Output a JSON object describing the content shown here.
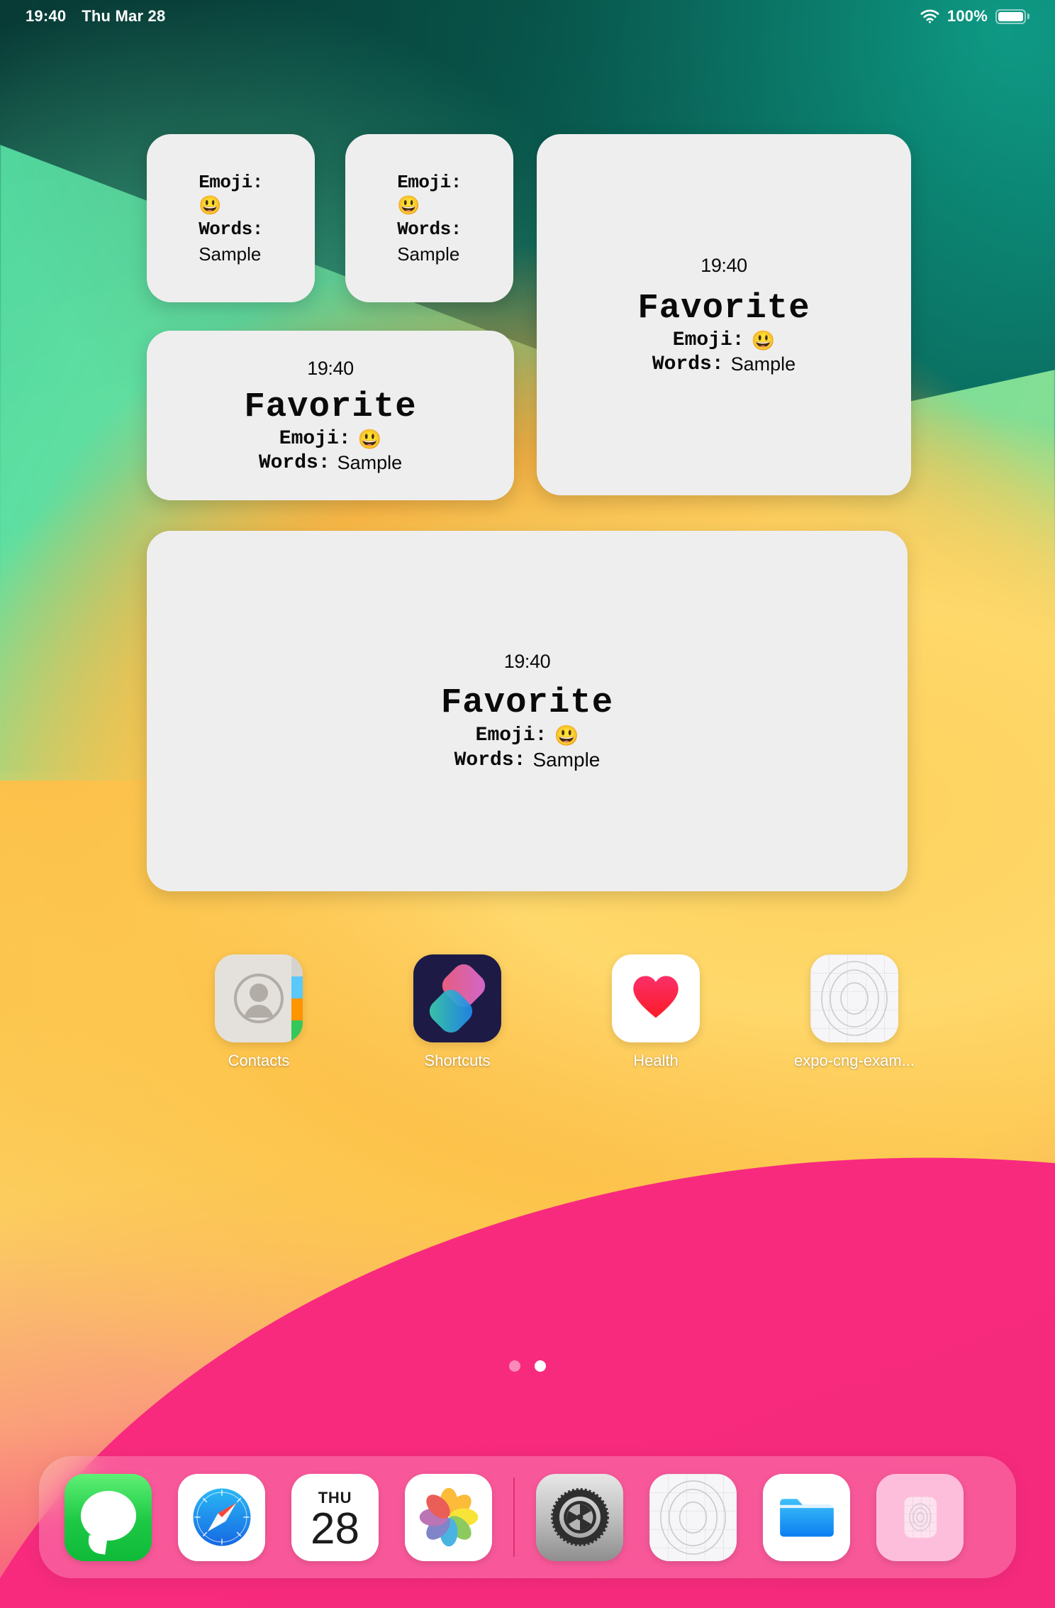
{
  "status_bar": {
    "time": "19:40",
    "date": "Thu Mar 28",
    "wifi_icon": "wifi-icon",
    "battery_percent": "100%",
    "battery_icon": "battery-full-icon"
  },
  "widgets": [
    {
      "id": "small-1",
      "size": "small",
      "emoji_label": "Emoji:",
      "emoji_value": "😃",
      "words_label": "Words:",
      "words_value": "Sample"
    },
    {
      "id": "small-2",
      "size": "small",
      "emoji_label": "Emoji:",
      "emoji_value": "😃",
      "words_label": "Words:",
      "words_value": "Sample"
    },
    {
      "id": "medium-right",
      "size": "medium",
      "time": "19:40",
      "title": "Favorite",
      "emoji_label": "Emoji:",
      "emoji_value": "😃",
      "words_label": "Words:",
      "words_value": "Sample"
    },
    {
      "id": "medium-left",
      "size": "medium",
      "time": "19:40",
      "title": "Favorite",
      "emoji_label": "Emoji:",
      "emoji_value": "😃",
      "words_label": "Words:",
      "words_value": "Sample"
    },
    {
      "id": "large",
      "size": "large",
      "time": "19:40",
      "title": "Favorite",
      "emoji_label": "Emoji:",
      "emoji_value": "😃",
      "words_label": "Words:",
      "words_value": "Sample"
    }
  ],
  "home_apps": [
    {
      "label": "Contacts",
      "icon": "contacts-icon"
    },
    {
      "label": "Shortcuts",
      "icon": "shortcuts-icon"
    },
    {
      "label": "Health",
      "icon": "health-icon"
    },
    {
      "label": "expo-cng-exam...",
      "icon": "expo-app-icon"
    }
  ],
  "page_dots": {
    "count": 2,
    "active_index": 1
  },
  "dock": {
    "apps_left": [
      {
        "name": "Messages",
        "icon": "messages-icon"
      },
      {
        "name": "Safari",
        "icon": "safari-icon"
      },
      {
        "name": "Calendar",
        "icon": "calendar-icon",
        "day_of_week": "THU",
        "day": "28"
      },
      {
        "name": "Photos",
        "icon": "photos-icon"
      }
    ],
    "apps_right": [
      {
        "name": "Settings",
        "icon": "settings-gear-icon"
      },
      {
        "name": "expo-cng-example",
        "icon": "expo-app-icon"
      },
      {
        "name": "Files",
        "icon": "files-folder-icon"
      },
      {
        "name": "Recent App",
        "icon": "recent-app-icon"
      }
    ]
  },
  "colors": {
    "widget_background": "#eeeeee",
    "wallpaper_teal": "#0a6b5e",
    "wallpaper_green": "#7fe3a0",
    "wallpaper_orange": "#fbb03b",
    "wallpaper_pink": "#fb2b80",
    "text_primary": "#0a0a0a",
    "status_text": "#ffffff"
  }
}
